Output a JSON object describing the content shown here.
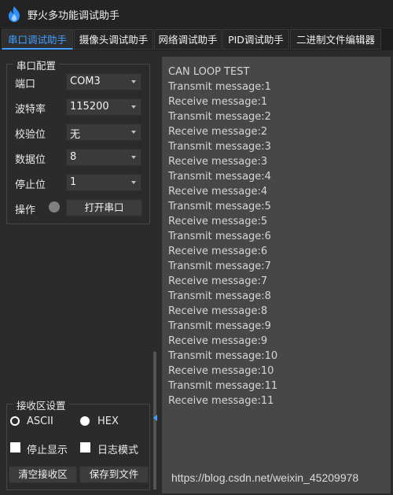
{
  "window": {
    "title": "野火多功能调试助手"
  },
  "tabs": [
    {
      "label": "串口调试助手",
      "active": true
    },
    {
      "label": "摄像头调试助手"
    },
    {
      "label": "网络调试助手"
    },
    {
      "label": "PID调试助手"
    },
    {
      "label": "二进制文件编辑器"
    }
  ],
  "serial_config": {
    "title": "串口配置",
    "port": {
      "label": "端口",
      "value": "COM3"
    },
    "baud": {
      "label": "波特率",
      "value": "115200"
    },
    "parity": {
      "label": "校验位",
      "value": "无"
    },
    "data_bits": {
      "label": "数据位",
      "value": "8"
    },
    "stop_bits": {
      "label": "停止位",
      "value": "1"
    },
    "operation": {
      "label": "操作",
      "button": "打开串口",
      "status_color": "#808080"
    }
  },
  "receive_settings": {
    "title": "接收区设置",
    "ascii_label": "ASCII",
    "ascii_selected": false,
    "hex_label": "HEX",
    "hex_selected": true,
    "stop_display_label": "停止显示",
    "stop_display_checked": false,
    "log_mode_label": "日志模式",
    "log_mode_checked": false,
    "clear_button": "清空接收区",
    "save_button": "保存到文件"
  },
  "output_lines": [
    "CAN LOOP TEST",
    "Transmit message:1",
    "Receive message:1",
    "Transmit message:2",
    "Receive message:2",
    "Transmit message:3",
    "Receive message:3",
    "Transmit message:4",
    "Receive message:4",
    "Transmit message:5",
    "Receive message:5",
    "Transmit message:6",
    "Receive message:6",
    "Transmit message:7",
    "Receive message:7",
    "Transmit message:8",
    "Receive message:8",
    "Transmit message:9",
    "Receive message:9",
    "Transmit message:10",
    "Receive message:10",
    "Transmit message:11",
    "Receive message:11"
  ],
  "watermark": "https://blog.csdn.net/weixin_45209978",
  "colors": {
    "accent": "#3f9fff",
    "background": "#2b2b2b",
    "output_bg": "#474747"
  }
}
